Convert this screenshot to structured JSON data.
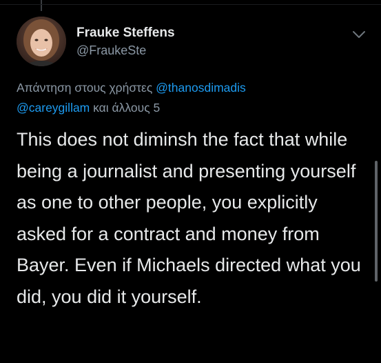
{
  "author": {
    "name": "Frauke Steffens",
    "handle": "@FraukeSte"
  },
  "reply": {
    "prefix": "Απάντηση στους χρήστες",
    "mention1": "@thanosdimadis",
    "mention2": "@careygillam",
    "suffix": "και άλλους 5"
  },
  "tweet": {
    "text": "This does not diminsh the fact that while being a journalist and presenting yourself as one to other people, you explicitly asked for a contract and money from Bayer. Even if Michaels directed what you did, you did it yourself."
  },
  "icons": {
    "menu": "chevron-down-icon",
    "avatar": "avatar"
  },
  "colors": {
    "background": "#000000",
    "text": "#e7e9ea",
    "secondary": "#8b98a5",
    "link": "#1d9bf0"
  }
}
